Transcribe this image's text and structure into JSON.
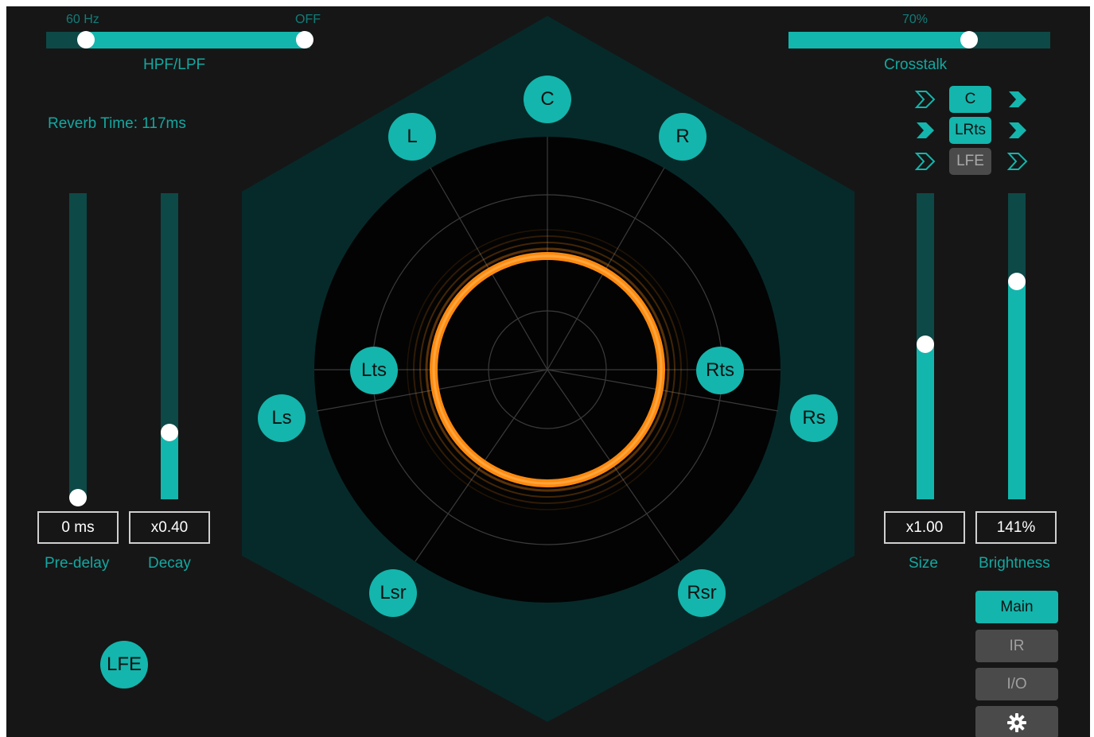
{
  "colors": {
    "accent": "#14b5ac",
    "track": "#0d4947",
    "background": "#161616",
    "hexagon": "#062a29",
    "ring": "#ff8a10"
  },
  "filter": {
    "hpf_value": "60 Hz",
    "lpf_value": "OFF",
    "label": "HPF/LPF"
  },
  "crosstalk": {
    "value_text": "70%",
    "label": "Crosstalk",
    "level": 0.7
  },
  "reverb_time": "Reverb Time: 117ms",
  "left_sliders": [
    {
      "value": "0 ms",
      "label": "Pre-delay",
      "level": 0.0
    },
    {
      "value": "x0.40",
      "label": "Decay",
      "level": 0.22
    }
  ],
  "right_sliders": [
    {
      "value": "x1.00",
      "label": "Size",
      "level": 0.5
    },
    {
      "value": "141%",
      "label": "Brightness",
      "level": 0.71
    }
  ],
  "routing": [
    {
      "label": "C",
      "active": true
    },
    {
      "label": "LRts",
      "active": true
    },
    {
      "label": "LFE",
      "active": false
    }
  ],
  "speakers": {
    "c": "C",
    "l": "L",
    "r": "R",
    "lts": "Lts",
    "rts": "Rts",
    "ls": "Ls",
    "rs": "Rs",
    "lsr": "Lsr",
    "rsr": "Rsr",
    "lfe": "LFE"
  },
  "nav": {
    "main": "Main",
    "ir": "IR",
    "io": "I/O",
    "settings_icon": "gear-icon"
  }
}
